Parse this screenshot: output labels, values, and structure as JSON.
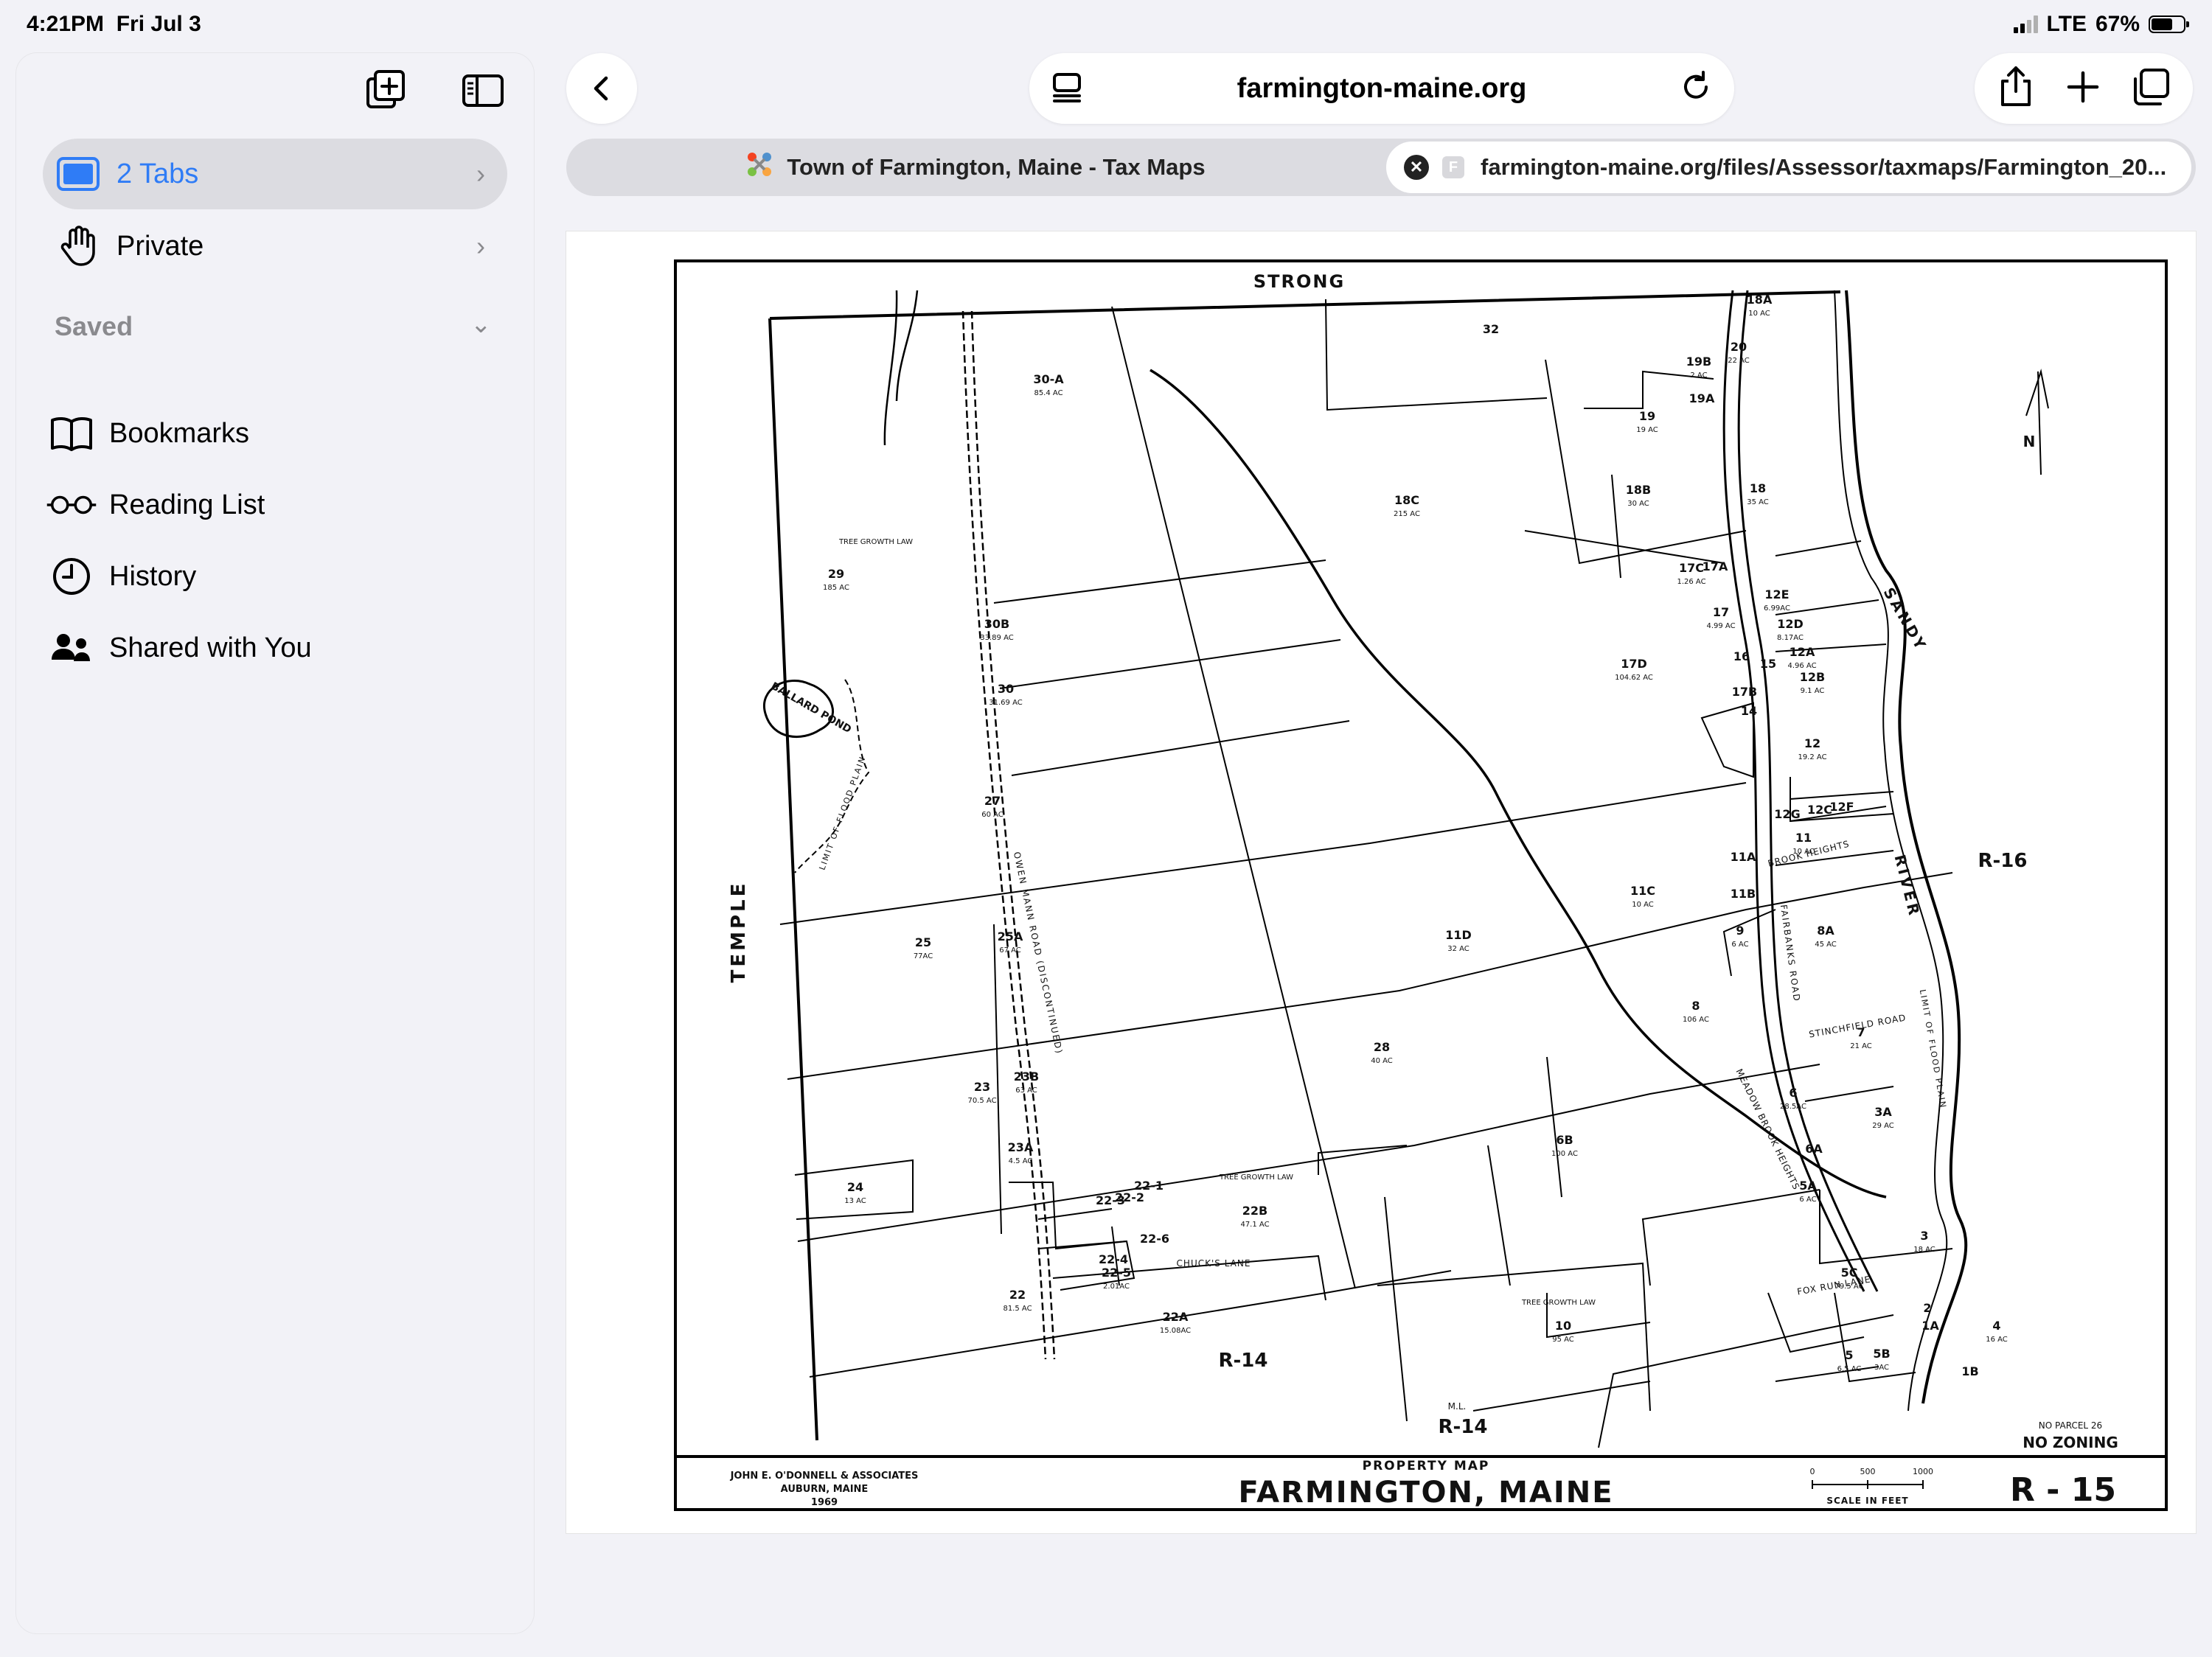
{
  "status": {
    "time": "4:21PM",
    "date": "Fri Jul 3",
    "network": "LTE",
    "battery": "67%",
    "battery_level": 0.67
  },
  "sidebar": {
    "tabs_row": {
      "label": "2 Tabs"
    },
    "private_row": {
      "label": "Private"
    },
    "saved_header": "Saved",
    "items": [
      {
        "label": "Bookmarks",
        "icon": "book-icon"
      },
      {
        "label": "Reading List",
        "icon": "glasses-icon"
      },
      {
        "label": "History",
        "icon": "clock-icon"
      },
      {
        "label": "Shared with You",
        "icon": "people-icon"
      }
    ]
  },
  "toolbar": {
    "url": "farmington-maine.org"
  },
  "tabs": [
    {
      "title": "Town of Farmington, Maine - Tax Maps",
      "favicon": "F"
    },
    {
      "title": "farmington-maine.org/files/Assessor/taxmaps/Farmington_20...",
      "favicon": "F"
    }
  ],
  "map": {
    "border_labels": {
      "top": "STRONG",
      "left": "TEMPLE",
      "right": "R-16",
      "bottom_left": "R-14",
      "bottom_right": "R-14",
      "no_parcel": "NO PARCEL 26",
      "no_zoning": "NO ZONING"
    },
    "feature_labels": {
      "river_sandy": "SANDY",
      "river_river": "RIVER",
      "pond": "BALLARD POND",
      "flood_plain": "LIMIT OF FLOOD PLAIN",
      "tree_growth": "TREE GROWTH LAW",
      "owen_mann": "OWEN MANN ROAD (DISCONTINUED)",
      "fairbanks": "FAIRBANKS ROAD",
      "brook_heights": "BROOK HEIGHTS",
      "stinchfield": "STINCHFIELD ROAD",
      "chucks_lane": "CHUCK'S LANE",
      "fox_run": "FOX RUN LANE",
      "meadow": "MEADOW BROOK HEIGHTS",
      "ml": "M.L.",
      "north": "N"
    },
    "parcels": [
      {
        "id": "32",
        "area": ""
      },
      {
        "id": "18A",
        "area": "10 AC"
      },
      {
        "id": "20",
        "area": "22 AC"
      },
      {
        "id": "19B",
        "area": "2 AC"
      },
      {
        "id": "19A",
        "area": ""
      },
      {
        "id": "19",
        "area": "19 AC"
      },
      {
        "id": "30-A",
        "area": "85.4 AC"
      },
      {
        "id": "18C",
        "area": "215 AC"
      },
      {
        "id": "18B",
        "area": "30 AC"
      },
      {
        "id": "18",
        "area": "35 AC"
      },
      {
        "id": "29",
        "area": "185 AC"
      },
      {
        "id": "30B",
        "area": "33.89 AC"
      },
      {
        "id": "30",
        "area": "31.69 AC"
      },
      {
        "id": "17C",
        "area": "1.26 AC"
      },
      {
        "id": "17A",
        "area": ""
      },
      {
        "id": "17",
        "area": "4.99 AC"
      },
      {
        "id": "12E",
        "area": "6.99AC"
      },
      {
        "id": "12D",
        "area": "8.17AC"
      },
      {
        "id": "17D",
        "area": "104.62 AC"
      },
      {
        "id": "16",
        "area": ""
      },
      {
        "id": "15",
        "area": ""
      },
      {
        "id": "12A",
        "area": "4.96 AC"
      },
      {
        "id": "12B",
        "area": "9.1 AC"
      },
      {
        "id": "17B",
        "area": ""
      },
      {
        "id": "14",
        "area": ""
      },
      {
        "id": "12",
        "area": "19.2 AC"
      },
      {
        "id": "27",
        "area": "60 AC"
      },
      {
        "id": "12G",
        "area": ""
      },
      {
        "id": "12C",
        "area": ""
      },
      {
        "id": "12F",
        "area": ""
      },
      {
        "id": "11",
        "area": "10 AC"
      },
      {
        "id": "11A",
        "area": ""
      },
      {
        "id": "11B",
        "area": ""
      },
      {
        "id": "11C",
        "area": "10 AC"
      },
      {
        "id": "25",
        "area": "77AC"
      },
      {
        "id": "25A",
        "area": "67 AC"
      },
      {
        "id": "11D",
        "area": "32 AC"
      },
      {
        "id": "9",
        "area": "6 AC"
      },
      {
        "id": "8A",
        "area": "45 AC"
      },
      {
        "id": "8",
        "area": "106 AC"
      },
      {
        "id": "7",
        "area": "21 AC"
      },
      {
        "id": "28",
        "area": "40 AC"
      },
      {
        "id": "23",
        "area": "70.5 AC"
      },
      {
        "id": "23B",
        "area": "63 AC"
      },
      {
        "id": "6",
        "area": "28.5AC"
      },
      {
        "id": "3A",
        "area": "29 AC"
      },
      {
        "id": "23A",
        "area": "4.5 AC"
      },
      {
        "id": "6B",
        "area": "100 AC"
      },
      {
        "id": "6A",
        "area": ""
      },
      {
        "id": "24",
        "area": "13 AC"
      },
      {
        "id": "5A",
        "area": "6 AC"
      },
      {
        "id": "22B",
        "area": "47.1 AC"
      },
      {
        "id": "22-1",
        "area": ""
      },
      {
        "id": "22-2",
        "area": ""
      },
      {
        "id": "22-3",
        "area": ""
      },
      {
        "id": "22-6",
        "area": ""
      },
      {
        "id": "22-4",
        "area": ""
      },
      {
        "id": "22-5",
        "area": "2.01AC"
      },
      {
        "id": "22",
        "area": "81.5 AC"
      },
      {
        "id": "22A",
        "area": "15.08AC"
      },
      {
        "id": "3",
        "area": "18 AC"
      },
      {
        "id": "5C",
        "area": "79.5 AC"
      },
      {
        "id": "10",
        "area": "95 AC"
      },
      {
        "id": "2",
        "area": ""
      },
      {
        "id": "1A",
        "area": ""
      },
      {
        "id": "4",
        "area": "16 AC"
      },
      {
        "id": "5",
        "area": "6.5 AC"
      },
      {
        "id": "5B",
        "area": "3AC"
      },
      {
        "id": "1B",
        "area": ""
      }
    ],
    "title_block": {
      "firm_line1": "JOHN E. O'DONNELL & ASSOCIATES",
      "firm_line2": "AUBURN, MAINE",
      "firm_line3": "1969",
      "map_type": "PROPERTY MAP",
      "town": "FARMINGTON, MAINE",
      "scale_ticks": [
        "0",
        "500",
        "1000"
      ],
      "scale_label": "SCALE IN FEET",
      "map_number": "R - 15"
    }
  }
}
